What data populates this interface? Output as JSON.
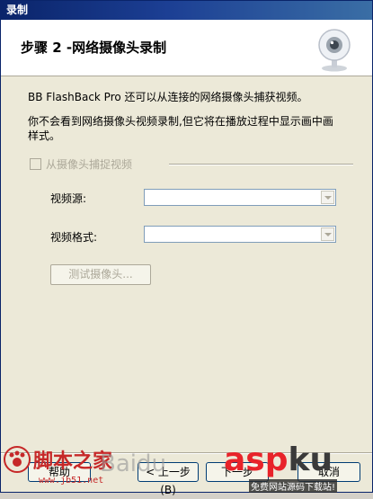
{
  "window": {
    "title": "录制"
  },
  "header": {
    "step_title": "步骤 2 -网络摄像头录制",
    "icon": "webcam-icon"
  },
  "content": {
    "intro": "BB FlashBack Pro 还可以从连接的网络摄像头捕获视频。",
    "note": "你不会看到网络摄像头视频录制,但它将在播放过程中显示画中画样式。",
    "capture_checkbox": {
      "label": "从摄像头捕捉视频",
      "checked": false,
      "enabled": false
    },
    "fields": [
      {
        "label": "视频源:",
        "value": ""
      },
      {
        "label": "视频格式:",
        "value": ""
      }
    ],
    "test_button": "测试摄像头..."
  },
  "footer": {
    "help": "帮助",
    "back": "< 上一步(B)",
    "next": "下一步",
    "cancel": "取消"
  },
  "watermarks": {
    "left_brand": "脚本之家",
    "left_site": "www.jb51.net",
    "baidu": "Baidu",
    "right_brand_a": "asp",
    "right_brand_b": "ku",
    "right_sub": "免费网站源码下载站!"
  }
}
